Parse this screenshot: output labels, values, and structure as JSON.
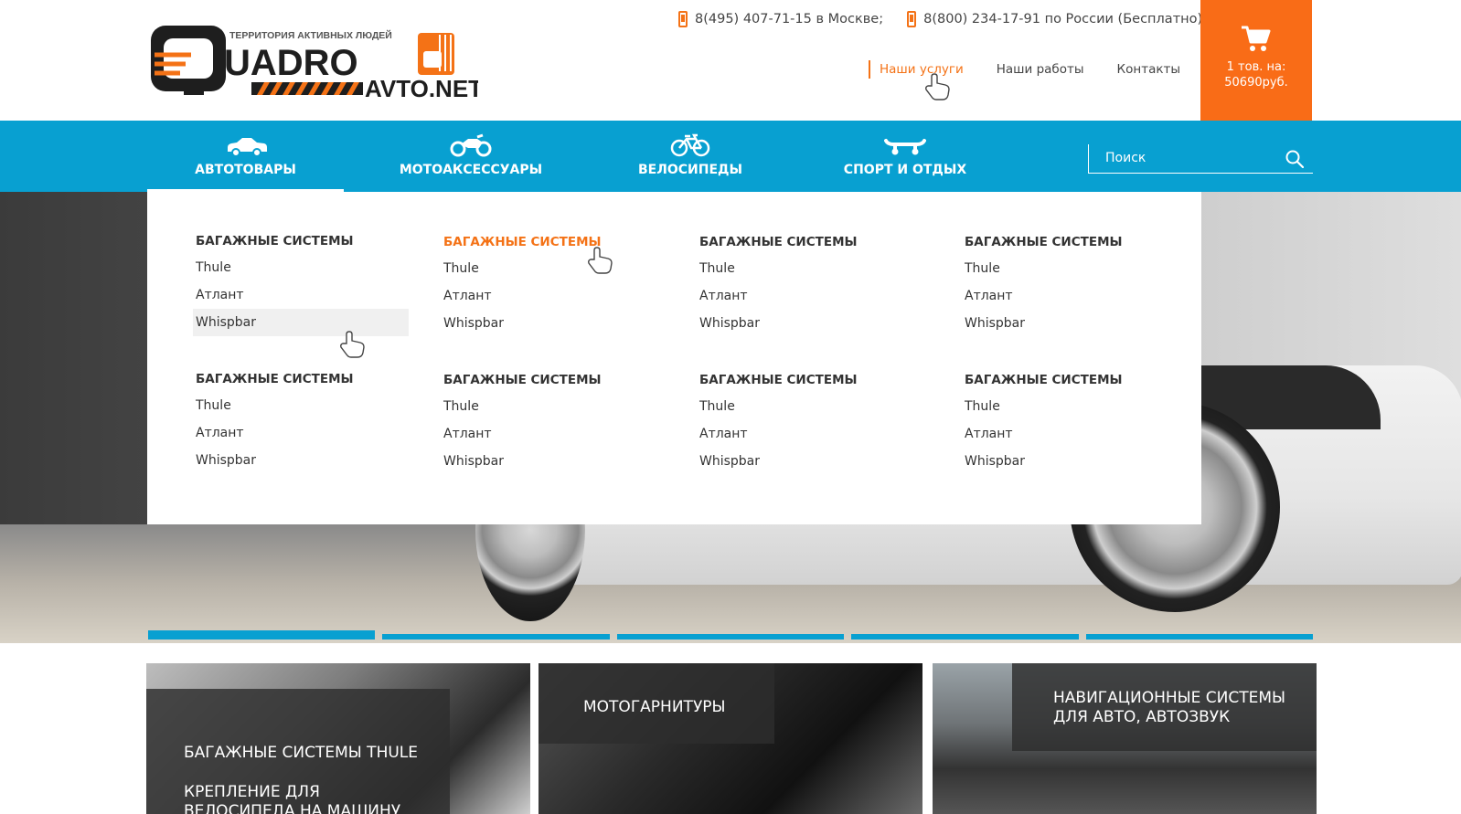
{
  "header": {
    "logo": {
      "tagline": "ТЕРРИТОРИЯ АКТИВНЫХ ЛЮДЕЙ",
      "word1": "UADRO",
      "word2": "AVTO.NET"
    },
    "phones": [
      {
        "text": "8(495) 407-71-15 в Москве;"
      },
      {
        "text": "8(800) 234-17-91 по России (Бесплатно)"
      }
    ],
    "nav": [
      {
        "label": "Наши услуги",
        "active": true
      },
      {
        "label": "Наши работы"
      },
      {
        "label": "Контакты"
      }
    ],
    "cart": {
      "line1": "1 тов. на:",
      "line2": "50690руб."
    }
  },
  "categories": [
    {
      "label": "АВТОТОВАРЫ",
      "icon": "car-icon",
      "active": true
    },
    {
      "label": "МОТОАКСЕССУАРЫ",
      "icon": "motorcycle-icon"
    },
    {
      "label": "ВЕЛОСИПЕДЫ",
      "icon": "bicycle-icon"
    },
    {
      "label": "СПОРТ И ОТДЫХ",
      "icon": "skateboard-icon"
    }
  ],
  "search": {
    "placeholder": "Поиск"
  },
  "mega_menu": {
    "columns": [
      {
        "groups": [
          {
            "title": "БАГАЖНЫЕ СИСТЕМЫ",
            "items": [
              "Thule",
              "Атлант",
              "Whispbar"
            ]
          },
          {
            "title": "БАГАЖНЫЕ СИСТЕМЫ",
            "items": [
              "Thule",
              "Атлант",
              "Whispbar"
            ]
          }
        ]
      },
      {
        "groups": [
          {
            "title": "БАГАЖНЫЕ СИСТЕМЫ",
            "items": [
              "Thule",
              "Атлант",
              "Whispbar"
            ]
          },
          {
            "title": "БАГАЖНЫЕ СИСТЕМЫ",
            "items": [
              "Thule",
              "Атлант",
              "Whispbar"
            ]
          }
        ]
      },
      {
        "groups": [
          {
            "title": "БАГАЖНЫЕ СИСТЕМЫ",
            "items": [
              "Thule",
              "Атлант",
              "Whispbar"
            ]
          },
          {
            "title": "БАГАЖНЫЕ СИСТЕМЫ",
            "items": [
              "Thule",
              "Атлант",
              "Whispbar"
            ]
          }
        ]
      },
      {
        "groups": [
          {
            "title": "БАГАЖНЫЕ СИСТЕМЫ",
            "items": [
              "Thule",
              "Атлант",
              "Whispbar"
            ]
          },
          {
            "title": "БАГАЖНЫЕ СИСТЕМЫ",
            "items": [
              "Thule",
              "Атлант",
              "Whispbar"
            ]
          }
        ]
      }
    ]
  },
  "tiles": [
    {
      "line1": "БАГАЖНЫЕ СИСТЕМЫ THULE",
      "line2": "КРЕПЛЕНИЕ ДЛЯ",
      "line3": "ВЕЛОСИПЕДА НА МАШИНУ"
    },
    {
      "line1": "МОТОГАРНИТУРЫ"
    },
    {
      "line1": "НАВИГАЦИОННЫЕ СИСТЕМЫ",
      "line2": "ДЛЯ АВТО, АВТОЗВУК"
    }
  ],
  "colors": {
    "accent": "#f47216",
    "cart_bg": "#f96c17",
    "bar": "#08a0d1"
  }
}
